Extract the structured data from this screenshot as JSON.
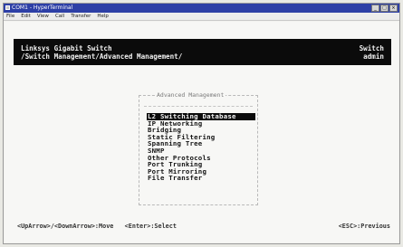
{
  "window": {
    "title": "COM1 - HyperTerminal",
    "buttons": [
      "_",
      "□",
      "×"
    ]
  },
  "menubar": {
    "items": [
      "File",
      "Edit",
      "View",
      "Call",
      "Transfer",
      "Help"
    ]
  },
  "header": {
    "line1_left": "Linksys Gigabit Switch",
    "line2_left": "/Switch Management/Advanced Management/",
    "line1_right": "Switch",
    "line2_right": "admin"
  },
  "menu": {
    "title": "Advanced Management",
    "selected_index": 0,
    "options": [
      "L2 Switching Database",
      "IP Networking",
      "Bridging",
      "Static Filtering",
      "Spanning Tree",
      "SNMP",
      "Other Protocols",
      "Port Trunking",
      "Port Mirroring",
      "File Transfer"
    ]
  },
  "footer": {
    "left": "<UpArrow>/<DownArrow>:Move   <Enter>:Select",
    "right": "<ESC>:Previous"
  },
  "colors": {
    "title_bar": "#2d3fa6",
    "header_bg": "#0b0b0b",
    "selection_bg": "#0b0b0b"
  }
}
